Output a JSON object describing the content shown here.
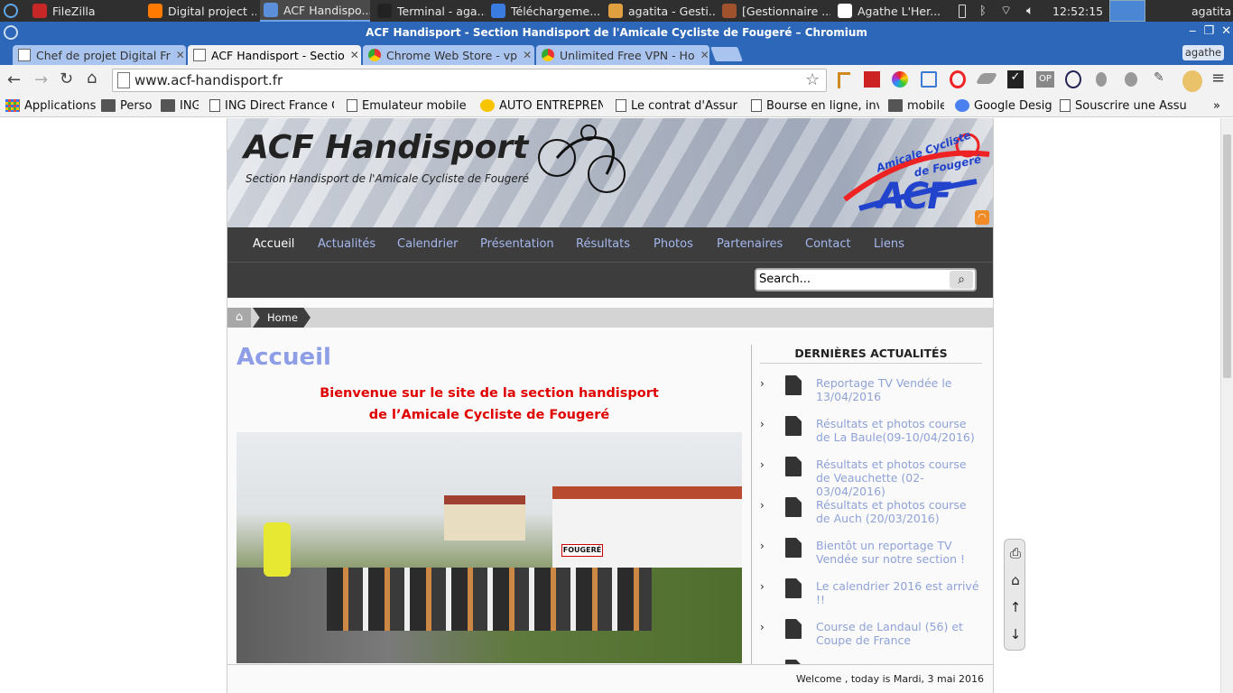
{
  "taskbar": {
    "items": [
      {
        "label": "FileZilla",
        "icon": "filezilla-icon",
        "color": "#c62828"
      },
      {
        "label": "Digital project ...",
        "icon": "firefox-icon",
        "color": "#ff7b00"
      },
      {
        "label": "ACF Handispo...",
        "icon": "chromium-icon",
        "color": "#5b8fd9"
      },
      {
        "label": "Terminal - aga...",
        "icon": "terminal-icon",
        "color": "#222222"
      },
      {
        "label": "Téléchargeme...",
        "icon": "download-icon",
        "color": "#3a7be0"
      },
      {
        "label": "agatita - Gesti...",
        "icon": "home-folder-icon",
        "color": "#e0a040"
      },
      {
        "label": "[Gestionnaire ...",
        "icon": "archive-icon",
        "color": "#a0522d"
      },
      {
        "label": "Agathe L'Her...",
        "icon": "document-icon",
        "color": "#ffffff"
      }
    ],
    "clock": "12:52:15",
    "user": "agatita"
  },
  "window": {
    "title": "ACF Handisport - Section Handisport de l'Amicale Cycliste de Fougeré – Chromium",
    "profile": "agathe"
  },
  "tabs": [
    {
      "label": "Chef de projet Digital Fr",
      "active": false
    },
    {
      "label": "ACF Handisport - Sectio",
      "active": true
    },
    {
      "label": "Chrome Web Store - vp",
      "active": false
    },
    {
      "label": "Unlimited Free VPN - Ho",
      "active": false
    }
  ],
  "toolbar": {
    "url": "www.acf-handisport.fr"
  },
  "bookmarks": [
    {
      "label": "Applications",
      "icon": "apps-grid-icon"
    },
    {
      "label": "Perso",
      "icon": "folder-icon"
    },
    {
      "label": "ING",
      "icon": "folder-icon"
    },
    {
      "label": "ING Direct France Co",
      "icon": "page-icon"
    },
    {
      "label": "Emulateur mobile (",
      "icon": "page-icon"
    },
    {
      "label": "AUTO ENTREPRENEU",
      "icon": "play-icon"
    },
    {
      "label": "Le contrat d'Assuran",
      "icon": "page-icon"
    },
    {
      "label": "Bourse en ligne, inv",
      "icon": "page-icon"
    },
    {
      "label": "mobile",
      "icon": "folder-icon"
    },
    {
      "label": "Google Design",
      "icon": "google-icon"
    },
    {
      "label": "Souscrire une Assur",
      "icon": "page-icon"
    }
  ],
  "site": {
    "title": "ACF Handisport",
    "subtitle": "Section Handisport de l'Amicale Cycliste de Fougeré",
    "logo_line1": "Amicale Cycliste",
    "logo_line2": "de Fougeré",
    "logo_mark": "ACF",
    "nav": [
      "Accueil",
      "Actualités",
      "Calendrier",
      "Présentation",
      "Résultats",
      "Photos",
      "Partenaires",
      "Contact",
      "Liens"
    ],
    "search_placeholder": "Search...",
    "breadcrumb": "Home",
    "heading": "Accueil",
    "welcome_line1": "Bienvenue sur le site de la section handisport",
    "welcome_line2": "de l’Amicale Cycliste de Fougeré",
    "photo_sign": "FOUGERÉ",
    "sidebar_title": "DERNIÈRES ACTUALITÉS",
    "news": [
      "Reportage TV Vendée le 13/04/2016",
      "Résultats et photos course de La Baule(09-10/04/2016)",
      "Résultats et photos course de Veauchette (02-03/04/2016)",
      "Résultats et photos course de Auch (20/03/2016)",
      "Bientôt un reportage TV Vendée sur notre section !",
      "Le calendrier 2016 est arrivé !!",
      "Course de Landaul (56) et Coupe de France"
    ],
    "footer": "Welcome , today is Mardi, 3 mai 2016"
  },
  "colors": {
    "nav_link": "#a5b8ee",
    "heading": "#8d9de6",
    "welcome": "#e00000",
    "news_link": "#8fa2d8"
  }
}
